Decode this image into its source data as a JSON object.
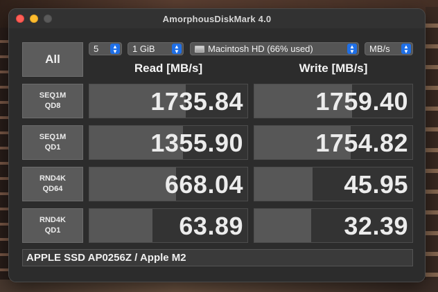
{
  "window": {
    "title": "AmorphousDiskMark 4.0"
  },
  "controls": {
    "all_label": "All",
    "count": "5",
    "size": "1 GiB",
    "drive": "Macintosh HD (66% used)",
    "unit": "MB/s"
  },
  "headers": {
    "read": "Read [MB/s]",
    "write": "Write [MB/s]"
  },
  "rows": [
    {
      "line1": "SEQ1M",
      "line2": "QD8",
      "read": "1735.84",
      "write": "1759.40",
      "read_fill": 0.61,
      "write_fill": 0.62
    },
    {
      "line1": "SEQ1M",
      "line2": "QD1",
      "read": "1355.90",
      "write": "1754.82",
      "read_fill": 0.59,
      "write_fill": 0.61
    },
    {
      "line1": "RND4K",
      "line2": "QD64",
      "read": "668.04",
      "write": "45.95",
      "read_fill": 0.55,
      "write_fill": 0.37
    },
    {
      "line1": "RND4K",
      "line2": "QD1",
      "read": "63.89",
      "write": "32.39",
      "read_fill": 0.4,
      "write_fill": 0.36
    }
  ],
  "comment": "APPLE SSD AP0256Z / Apple M2",
  "colors": {
    "close": "#ff5f57",
    "minimize": "#febc2e",
    "accent": "#1f6fe6"
  }
}
